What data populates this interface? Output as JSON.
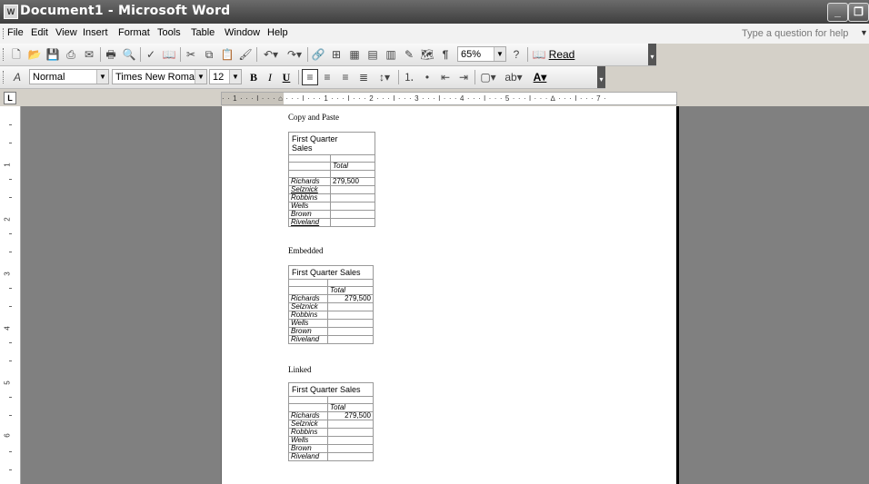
{
  "window": {
    "title": "Document1 - Microsoft Word",
    "app_icon": "word-doc-icon",
    "controls": {
      "minimize": "_",
      "restore": "❐",
      "close": "✕"
    }
  },
  "menubar": {
    "items": [
      "File",
      "Edit",
      "View",
      "Insert",
      "Format",
      "Tools",
      "Table",
      "Window",
      "Help"
    ],
    "help_placeholder": "Type a question for help"
  },
  "standard_toolbar": {
    "zoom": "65%",
    "read_label": "Read"
  },
  "formatting_toolbar": {
    "style": "Normal",
    "font": "Times New Roman",
    "size": "12",
    "bold": "B",
    "italic": "I",
    "underline": "U"
  },
  "ruler": {
    "text": "· · 1 · · · ǀ · · · ⌂ · · · ǀ · · · 1 · · · ǀ · · · 2 · · · ǀ · · · 3 · · · ǀ · · · 4 · · · ǀ · · · 5 · · · ǀ · · · ∆ · · · ǀ · · · 7 ·"
  },
  "document": {
    "sections": [
      {
        "heading": "Copy and Paste",
        "table_title": "First Quarter Sales",
        "total_label": "Total",
        "rows": [
          {
            "name": "Richards",
            "value": "279,500"
          },
          {
            "name": "Selznick",
            "value": ""
          },
          {
            "name": "Robbins",
            "value": ""
          },
          {
            "name": "Wells",
            "value": ""
          },
          {
            "name": "Brown",
            "value": ""
          },
          {
            "name": "Riveland",
            "value": ""
          }
        ]
      },
      {
        "heading": "Embedded",
        "table_title": "First Quarter Sales",
        "total_label": "Total",
        "rows": [
          {
            "name": "Richards",
            "value": "279,500"
          },
          {
            "name": "Selznick",
            "value": ""
          },
          {
            "name": "Robbins",
            "value": ""
          },
          {
            "name": "Wells",
            "value": ""
          },
          {
            "name": "Brown",
            "value": ""
          },
          {
            "name": "Riveland",
            "value": ""
          }
        ]
      },
      {
        "heading": "Linked",
        "table_title": "First Quarter Sales",
        "total_label": "Total",
        "rows": [
          {
            "name": "Richards",
            "value": "279,500"
          },
          {
            "name": "Selznick",
            "value": ""
          },
          {
            "name": "Robbins",
            "value": ""
          },
          {
            "name": "Wells",
            "value": ""
          },
          {
            "name": "Brown",
            "value": ""
          },
          {
            "name": "Riveland",
            "value": ""
          }
        ]
      }
    ]
  },
  "vertical_ruler": {
    "numbers": [
      "1",
      "2",
      "3",
      "4",
      "5",
      "6"
    ]
  }
}
